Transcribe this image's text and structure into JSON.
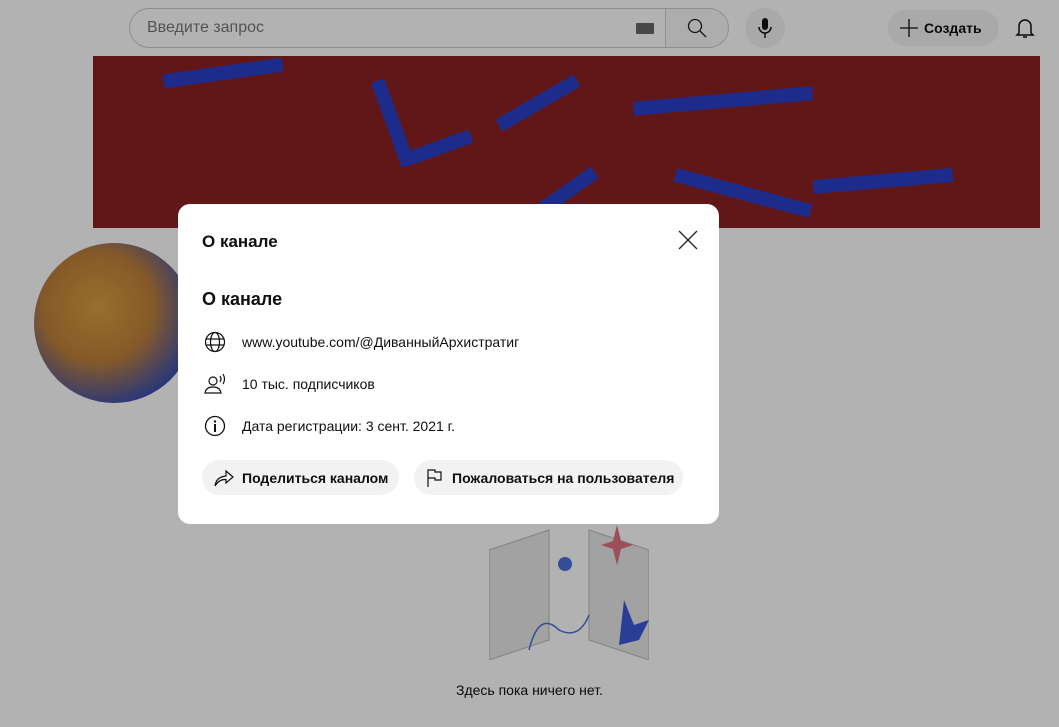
{
  "header": {
    "search_placeholder": "Введите запрос",
    "create_label": "Создать"
  },
  "empty_state": {
    "text": "Здесь пока ничего нет."
  },
  "dialog": {
    "title": "О канале",
    "section_title": "О канале",
    "url": "www.youtube.com/@ДиванныйАрхистратиг",
    "subscribers": "10 тыс. подписчиков",
    "joined": "Дата регистрации: 3 сент. 2021 г.",
    "share_label": "Поделиться каналом",
    "report_label": "Пожаловаться на пользователя"
  }
}
